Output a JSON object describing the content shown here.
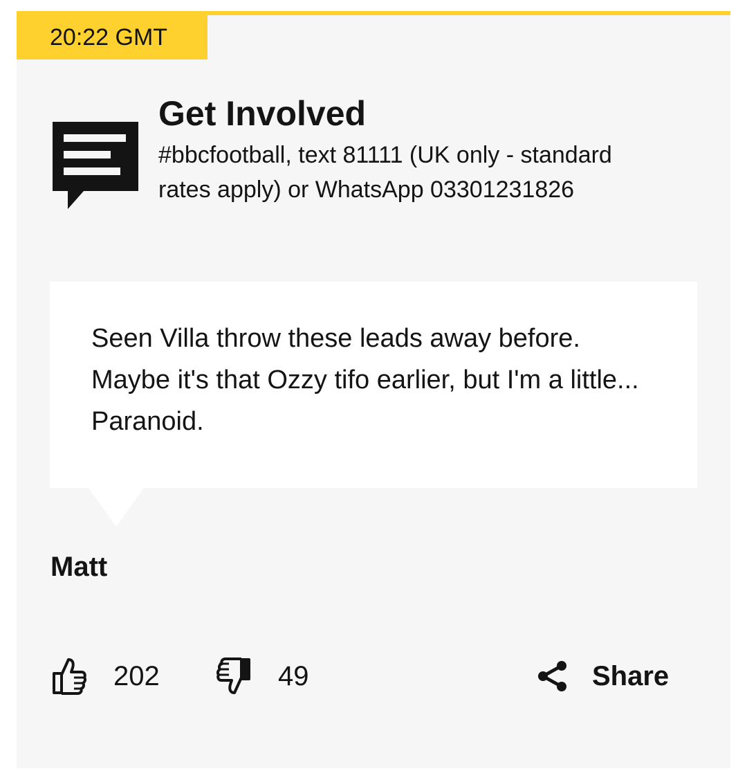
{
  "timestamp": "20:22 GMT",
  "get_involved": {
    "title": "Get Involved",
    "description": "#bbcfootball, text 81111 (UK only - standard rates apply) or WhatsApp 03301231826",
    "icon": "comment-icon"
  },
  "comment": {
    "text": "Seen Villa throw these leads away before. Maybe it's that Ozzy tifo earlier, but I'm a little... Paranoid.",
    "author": "Matt"
  },
  "actions": {
    "likes": "202",
    "dislikes": "49",
    "share_label": "Share"
  },
  "colors": {
    "accent": "#fed12f",
    "card_background": "#f6f6f6",
    "quote_background": "#ffffff",
    "text": "#141414"
  }
}
